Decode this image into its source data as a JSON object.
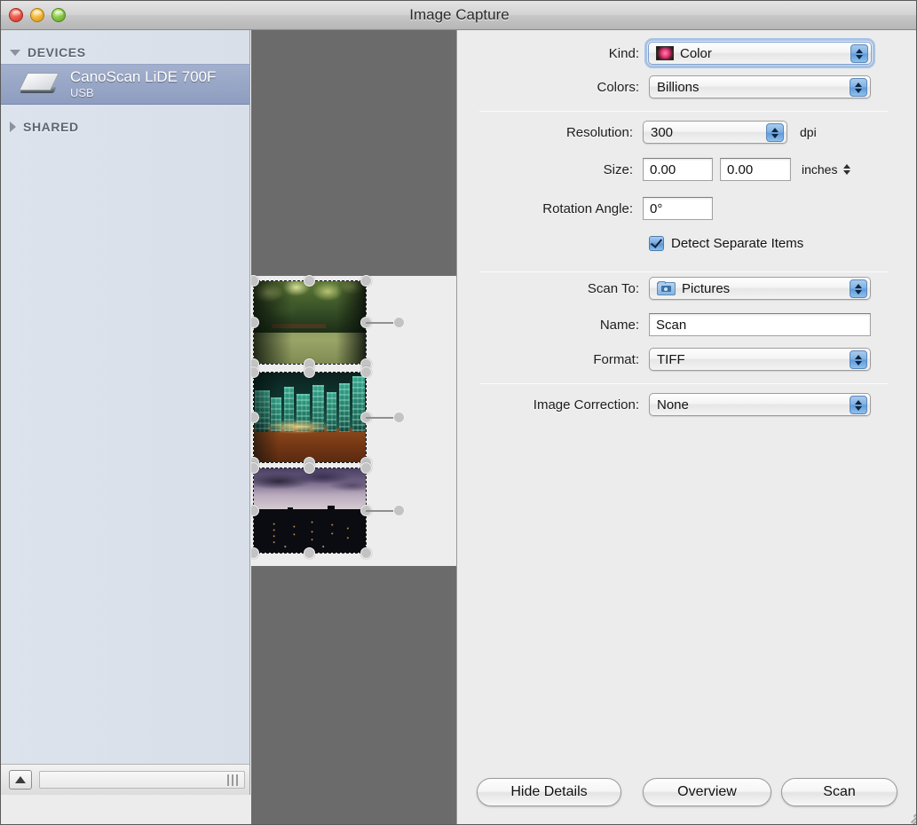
{
  "window": {
    "title": "Image Capture",
    "controls": {
      "close": "close",
      "minimize": "minimize",
      "zoom": "zoom"
    }
  },
  "sidebar": {
    "sections": [
      {
        "label": "DEVICES",
        "expanded": true,
        "items": [
          {
            "name": "CanoScan LiDE 700F",
            "subtitle": "USB",
            "icon": "scanner-icon",
            "selected": true
          }
        ]
      },
      {
        "label": "SHARED",
        "expanded": false,
        "items": []
      }
    ],
    "eject_label": "eject-icon"
  },
  "preview": {
    "selections": [
      {
        "label": "scan-selection-1",
        "art": "forest-river"
      },
      {
        "label": "scan-selection-2",
        "art": "teal-buildings"
      },
      {
        "label": "scan-selection-3",
        "art": "night-cityscape"
      }
    ]
  },
  "settings": {
    "kind": {
      "label": "Kind:",
      "value": "Color",
      "icon": "rose-thumbnail",
      "focused": true
    },
    "colors": {
      "label": "Colors:",
      "value": "Billions"
    },
    "resolution": {
      "label": "Resolution:",
      "value": "300",
      "unit": "dpi"
    },
    "size": {
      "label": "Size:",
      "width_value": "0.00",
      "height_value": "0.00",
      "unit": "inches"
    },
    "rotation": {
      "label": "Rotation Angle:",
      "value": "0°"
    },
    "detect_separate_items": {
      "label": "Detect Separate Items",
      "checked": true
    },
    "scan_to": {
      "label": "Scan To:",
      "value": "Pictures",
      "icon": "folder-pictures-icon"
    },
    "name": {
      "label": "Name:",
      "value": "Scan"
    },
    "format": {
      "label": "Format:",
      "value": "TIFF"
    },
    "image_correction": {
      "label": "Image Correction:",
      "value": "None"
    }
  },
  "actions": {
    "hide_details": "Hide Details",
    "overview": "Overview",
    "scan": "Scan"
  },
  "colors": {
    "selection_blue": "#8e9dc0",
    "accent_blue": "#5e9ada",
    "window_bg": "#ececec",
    "preview_bg": "#6b6b6b",
    "scanbed": "#ededed"
  }
}
